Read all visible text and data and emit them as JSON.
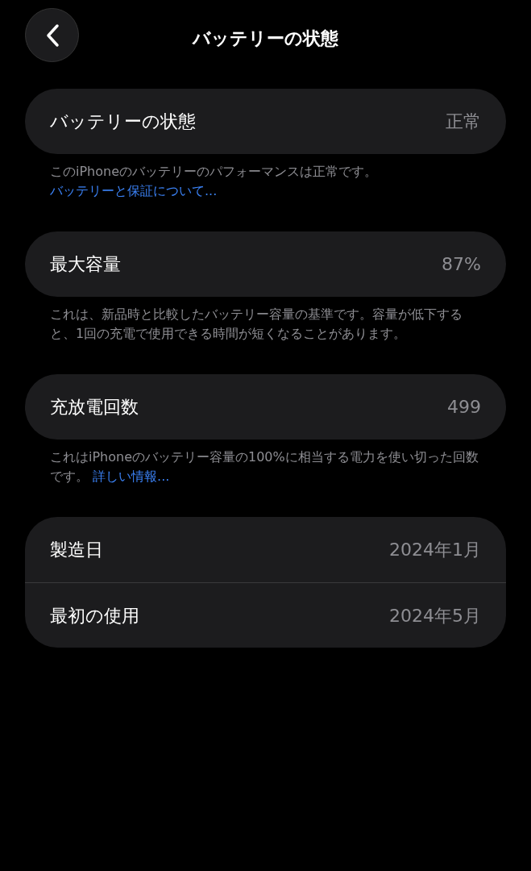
{
  "nav": {
    "title": "バッテリーの状態"
  },
  "sections": [
    {
      "rows": [
        {
          "label": "バッテリーの状態",
          "value": "正常"
        }
      ],
      "footer": {
        "text": "このiPhoneのバッテリーのパフォーマンスは正常です。",
        "link": "バッテリーと保証について..."
      }
    },
    {
      "rows": [
        {
          "label": "最大容量",
          "value": "87%"
        }
      ],
      "footer": {
        "text": "これは、新品時と比較したバッテリー容量の基準です。容量が低下すると、1回の充電で使用できる時間が短くなることがあります。"
      }
    },
    {
      "rows": [
        {
          "label": "充放電回数",
          "value": "499"
        }
      ],
      "footer": {
        "text": "これはiPhoneのバッテリー容量の100%に相当する電力を使い切った回数です。",
        "link": "詳しい情報..."
      }
    },
    {
      "rows": [
        {
          "label": "製造日",
          "value": "2024年1月"
        },
        {
          "label": "最初の使用",
          "value": "2024年5月"
        }
      ]
    }
  ]
}
